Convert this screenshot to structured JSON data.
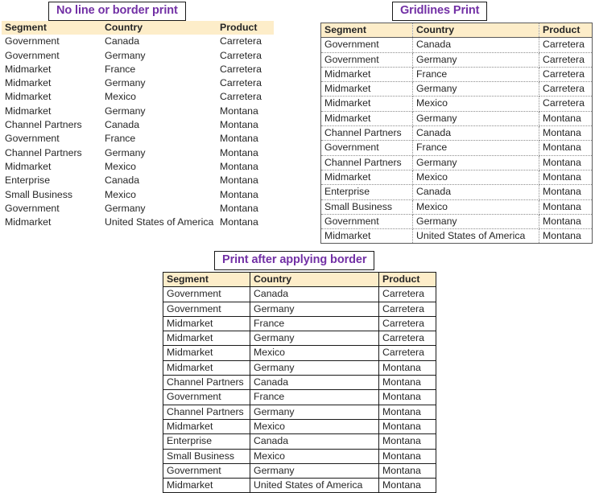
{
  "colors": {
    "title_text": "#7230a5",
    "header_fill": "#fdedc9",
    "body_text": "#262626",
    "solid_border": "#1a1a1a",
    "gridline": "#8c8c8c"
  },
  "panels": {
    "plain": {
      "title": "No line or border print",
      "columns": [
        "Segment",
        "Country",
        "Product"
      ]
    },
    "gridlines": {
      "title": "Gridlines Print",
      "columns": [
        "Segment",
        "Country",
        "Product"
      ]
    },
    "bordered": {
      "title": "Print after applying border",
      "columns": [
        "Segment",
        "Country",
        "Product"
      ]
    }
  },
  "rows": [
    [
      "Government",
      "Canada",
      "Carretera"
    ],
    [
      "Government",
      "Germany",
      "Carretera"
    ],
    [
      "Midmarket",
      "France",
      "Carretera"
    ],
    [
      "Midmarket",
      "Germany",
      "Carretera"
    ],
    [
      "Midmarket",
      "Mexico",
      "Carretera"
    ],
    [
      "Midmarket",
      "Germany",
      "Montana"
    ],
    [
      "Channel Partners",
      "Canada",
      "Montana"
    ],
    [
      "Government",
      "France",
      "Montana"
    ],
    [
      "Channel Partners",
      "Germany",
      "Montana"
    ],
    [
      "Midmarket",
      "Mexico",
      "Montana"
    ],
    [
      "Enterprise",
      "Canada",
      "Montana"
    ],
    [
      "Small Business",
      "Mexico",
      "Montana"
    ],
    [
      "Government",
      "Germany",
      "Montana"
    ],
    [
      "Midmarket",
      "United States of America",
      "Montana"
    ]
  ]
}
